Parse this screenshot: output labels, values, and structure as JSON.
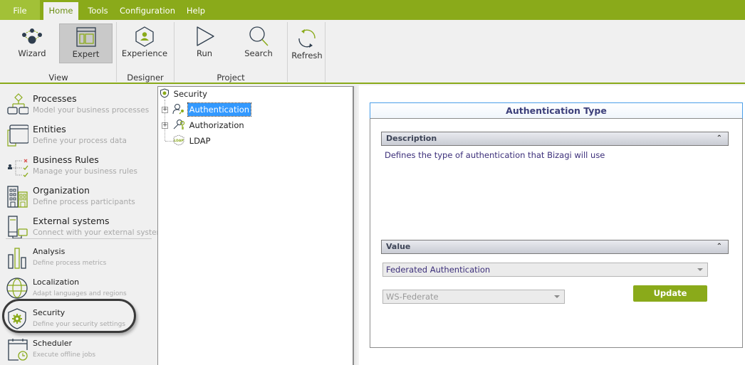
{
  "menu": {
    "tabs": [
      {
        "label": "File"
      },
      {
        "label": "Home",
        "active": true
      },
      {
        "label": "Tools"
      },
      {
        "label": "Configuration"
      },
      {
        "label": "Help"
      }
    ]
  },
  "ribbon": {
    "groups": [
      {
        "label": "View"
      },
      {
        "label": "Designer"
      },
      {
        "label": "Project"
      }
    ],
    "buttons": {
      "wizard": {
        "label": "Wizard",
        "icon": "wizard-icon"
      },
      "expert": {
        "label": "Expert",
        "icon": "expert-layout-icon",
        "selected": true
      },
      "experience": {
        "label": "Experience",
        "icon": "experience-hexagon-icon"
      },
      "run": {
        "label": "Run",
        "icon": "play-icon"
      },
      "search": {
        "label": "Search",
        "icon": "search-icon"
      },
      "refresh": {
        "label": "Refresh",
        "icon": "refresh-icon"
      }
    }
  },
  "sidebar": {
    "items": [
      {
        "title": "Processes",
        "subtitle": "Model your business processes",
        "icon": "processes-icon"
      },
      {
        "title": "Entities",
        "subtitle": "Define your process data",
        "icon": "entities-icon"
      },
      {
        "title": "Business Rules",
        "subtitle": "Manage your business rules",
        "icon": "business-rules-icon"
      },
      {
        "title": "Organization",
        "subtitle": "Define process participants",
        "icon": "organization-icon"
      },
      {
        "title": "External systems",
        "subtitle": "Connect with your external systems",
        "icon": "external-systems-icon"
      },
      {
        "title": "Analysis",
        "subtitle": "Define process metrics",
        "icon": "analysis-icon"
      },
      {
        "title": "Localization",
        "subtitle": "Adapt languages and regions",
        "icon": "globe-icon"
      },
      {
        "title": "Security",
        "subtitle": "Define your security settings",
        "icon": "security-shield-icon",
        "highlighted": true
      },
      {
        "title": "Scheduler",
        "subtitle": "Execute offline jobs",
        "icon": "scheduler-icon"
      }
    ]
  },
  "tree": {
    "root": {
      "label": "Security",
      "icon": "security-shield-icon"
    },
    "children": [
      {
        "label": "Authentication",
        "icon": "authentication-user-key-icon",
        "expandable": true,
        "selected": true
      },
      {
        "label": "Authorization",
        "icon": "authorization-key-icon",
        "expandable": true
      },
      {
        "label": "LDAP",
        "icon": "ldap-icon",
        "expandable": false
      }
    ]
  },
  "detail": {
    "title": "Authentication Type",
    "description_section": {
      "label": "Description",
      "text": "Defines the type of authentication that Bizagi will use"
    },
    "value_section": {
      "label": "Value",
      "auth_type_value": "Federated Authentication",
      "protocol_value": "WS-Federate",
      "protocol_disabled": true,
      "update_label": "Update"
    }
  },
  "colors": {
    "brand_green": "#8aaa1a",
    "file_tab": "#a2c137",
    "title_text": "#3c3f7a",
    "selection_blue": "#3399ff"
  }
}
